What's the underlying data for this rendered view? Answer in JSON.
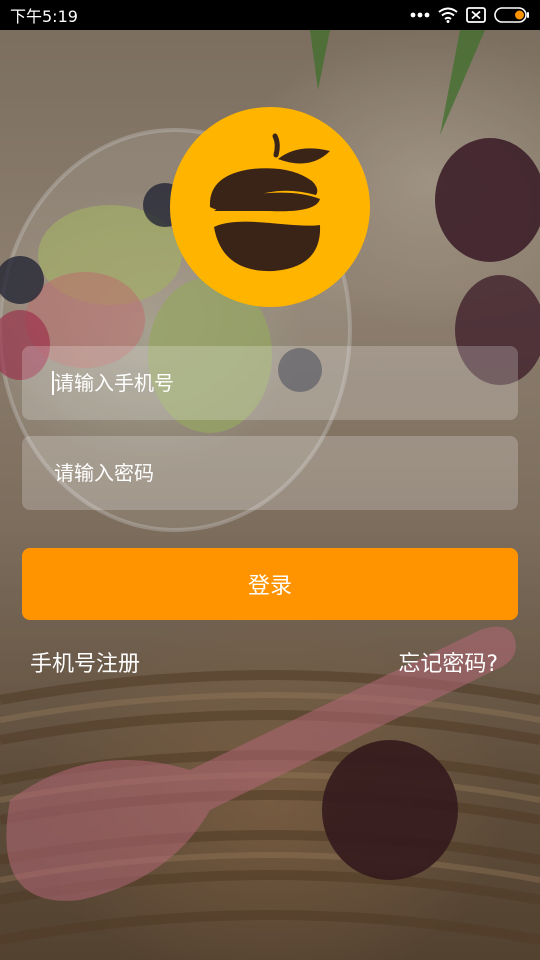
{
  "status_bar": {
    "time": "下午5:19"
  },
  "logo": {
    "color": "#FFB400",
    "mark_color": "#3A2418"
  },
  "form": {
    "phone_placeholder": "请输入手机号",
    "password_placeholder": "请输入密码",
    "login_label": "登录"
  },
  "links": {
    "register": "手机号注册",
    "forgot": "忘记密码?"
  },
  "colors": {
    "accent": "#FF9400"
  }
}
